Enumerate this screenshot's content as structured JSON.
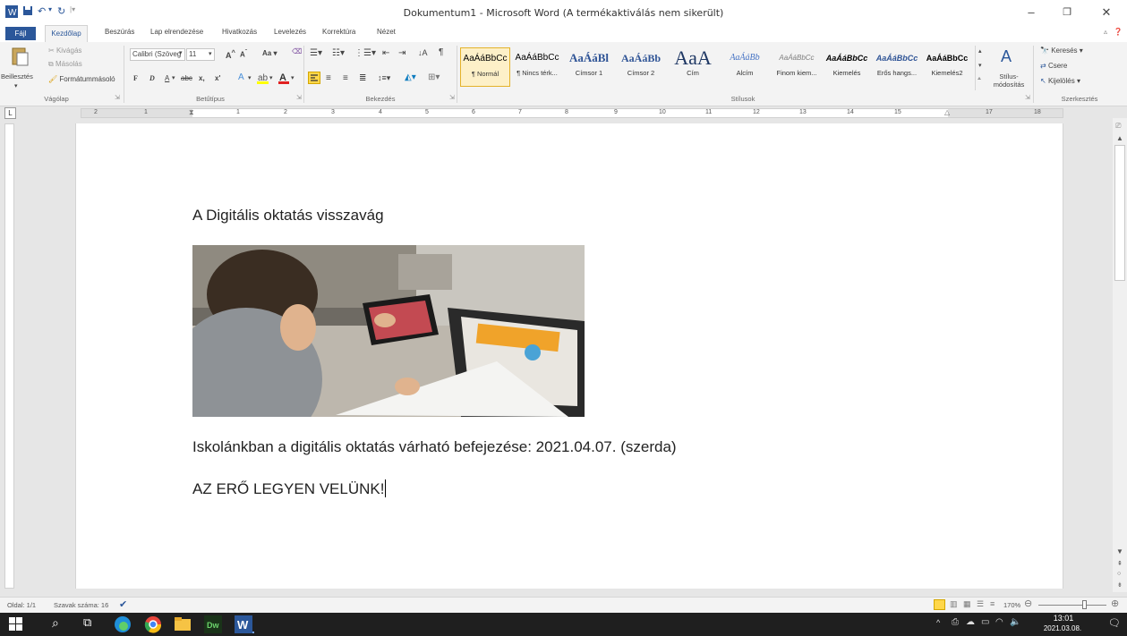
{
  "window": {
    "title": "Dokumentum1 - Microsoft Word (A termékaktiválás nem sikerült)"
  },
  "tabs": [
    "Fájl",
    "Kezdőlap",
    "Beszúrás",
    "Lap elrendezése",
    "Hivatkozás",
    "Levelezés",
    "Korrektúra",
    "Nézet"
  ],
  "clipboard": {
    "paste": "Beillesztés",
    "cut": "Kivágás",
    "copy": "Másolás",
    "format_painter": "Formátummásoló",
    "group": "Vágólap"
  },
  "font": {
    "name": "Calibri (Szöveg",
    "size": "11",
    "case": "Aa",
    "bold": "F",
    "italic": "D",
    "underline": "A",
    "strike": "abc",
    "sub": "x,",
    "sup": "x'",
    "group": "Betűtípus"
  },
  "paragraph": {
    "group": "Bekezdés"
  },
  "styles": {
    "group": "Stílusok",
    "items": [
      {
        "preview": "AaÁáBbCc",
        "name": "¶ Normál"
      },
      {
        "preview": "AaÁáBbCc",
        "name": "¶ Nincs térk..."
      },
      {
        "preview": "AaÁáBl",
        "name": "Címsor 1"
      },
      {
        "preview": "AaÁáBb",
        "name": "Címsor 2"
      },
      {
        "preview": "AaA",
        "name": "Cím"
      },
      {
        "preview": "AaÁáBb",
        "name": "Alcím"
      },
      {
        "preview": "AaÁáBbCc",
        "name": "Finom kiem..."
      },
      {
        "preview": "AaÁáBbCc",
        "name": "Kiemelés"
      },
      {
        "preview": "AaÁáBbCc",
        "name": "Erős hangs..."
      },
      {
        "preview": "AaÁáBbCc",
        "name": "Kiemelés2"
      }
    ],
    "change": "Stílus-módosítás"
  },
  "editing": {
    "find": "Keresés",
    "replace": "Csere",
    "select": "Kijelölés",
    "group": "Szerkesztés"
  },
  "ruler": [
    "2",
    "1",
    "1",
    "2",
    "3",
    "4",
    "5",
    "6",
    "7",
    "8",
    "9",
    "10",
    "11",
    "12",
    "13",
    "14",
    "15",
    "17",
    "18"
  ],
  "document": {
    "heading": "A Digitális oktatás visszavág",
    "line1": "Iskolánkban a digitális oktatás várható befejezése:  2021.04.07. (szerda)",
    "line2": "AZ ERŐ LEGYEN VELÜNK!"
  },
  "status": {
    "page": "Oldal: 1/1",
    "words": "Szavak száma: 16",
    "zoom": "170%"
  },
  "taskbar": {
    "time": "13:01",
    "date": "2021.03.08."
  },
  "colors": {
    "accent": "#2b579a",
    "taskbar": "#1f1f1f"
  }
}
